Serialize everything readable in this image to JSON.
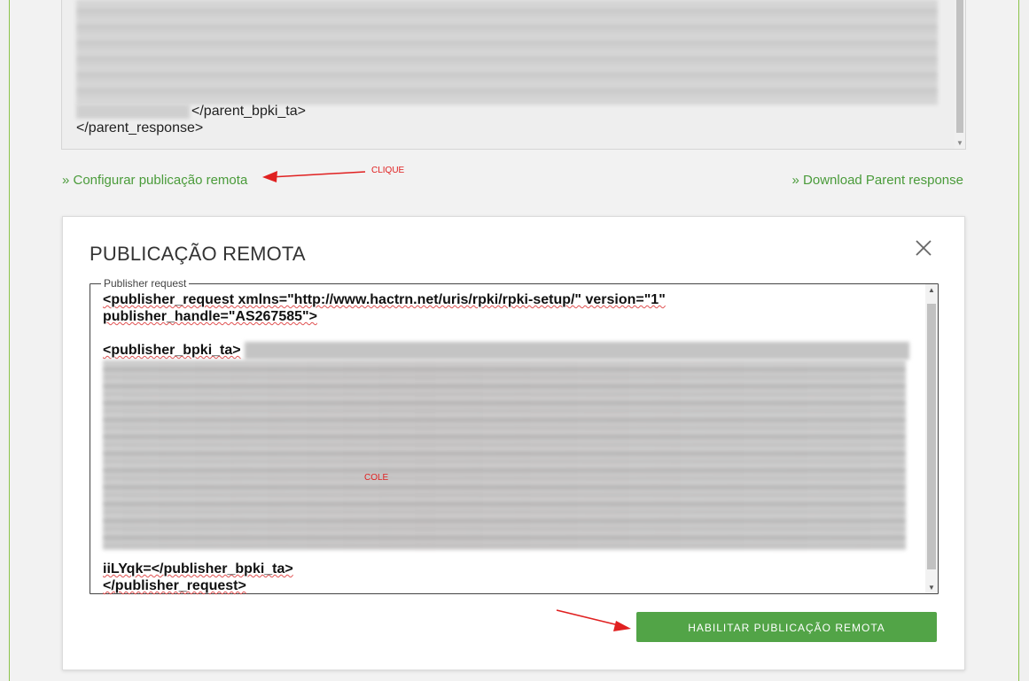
{
  "response": {
    "line_close_bpki": "</parent_bpki_ta>",
    "line_close_response": "</parent_response>"
  },
  "links": {
    "configure_remote": "» Configurar publicação remota",
    "download_parent": "» Download Parent response"
  },
  "annotations": {
    "clique": "CLIQUE",
    "cole": "COLE",
    "color": "#e02020"
  },
  "modal": {
    "title": "PUBLICAÇÃO REMOTA",
    "legend": "Publisher request",
    "textarea": {
      "line1_a": "<publisher_request xmlns=\"http://www.hactrn.net/uris/rpki/rpki-setup/\" version=\"1\"",
      "line2": "publisher_handle=\"AS267585\">",
      "line3": "<publisher_bpki_ta>",
      "line_last_partial": "iiLYqk=</publisher_bpki_ta>",
      "line_close": "</publisher_request>"
    },
    "button": "HABILITAR PUBLICAÇÃO REMOTA",
    "button_color": "#52a447"
  },
  "icons": {
    "close": "close-icon",
    "arrow": "red-arrow-icon"
  }
}
